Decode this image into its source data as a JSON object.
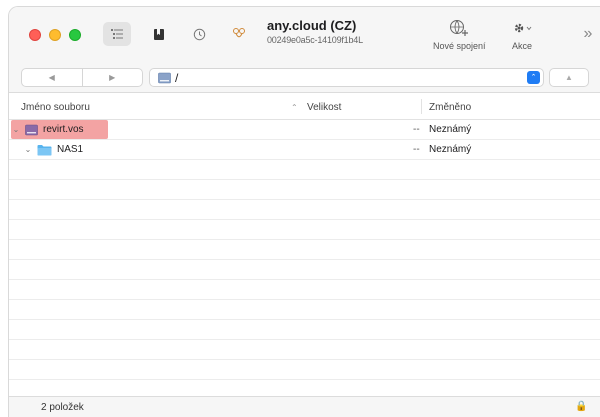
{
  "toolbar": {
    "connection_title": "any.cloud (CZ)",
    "connection_subtitle": "00249e0a5c-14109f1b4L",
    "new_connection_label": "Nové spojení",
    "action_label": "Akce",
    "overflow_glyph": "»"
  },
  "pathbar": {
    "back_glyph": "◀",
    "forward_glyph": "▶",
    "path": "/",
    "dropdown_glyph": "⌃",
    "up_glyph": "▲"
  },
  "columns": {
    "name": "Jméno souboru",
    "size": "Velikost",
    "modified": "Změněno",
    "sort_glyph": "⌃"
  },
  "rows": [
    {
      "name": "revirt.vos",
      "size": "--",
      "modified": "Neznámý",
      "icon": "volume-icon",
      "selected": true,
      "indent": 0,
      "expanded": true
    },
    {
      "name": "NAS1",
      "size": "--",
      "modified": "Neznámý",
      "icon": "folder-icon",
      "selected": false,
      "indent": 1,
      "expanded": true
    }
  ],
  "status": {
    "item_count": "2 položek",
    "lock_glyph": "🔒"
  },
  "colors": {
    "selection": "#f3a3a3",
    "accent": "#1f7cf4",
    "folder": "#58b4ee",
    "volume": "#8a6aa8"
  }
}
